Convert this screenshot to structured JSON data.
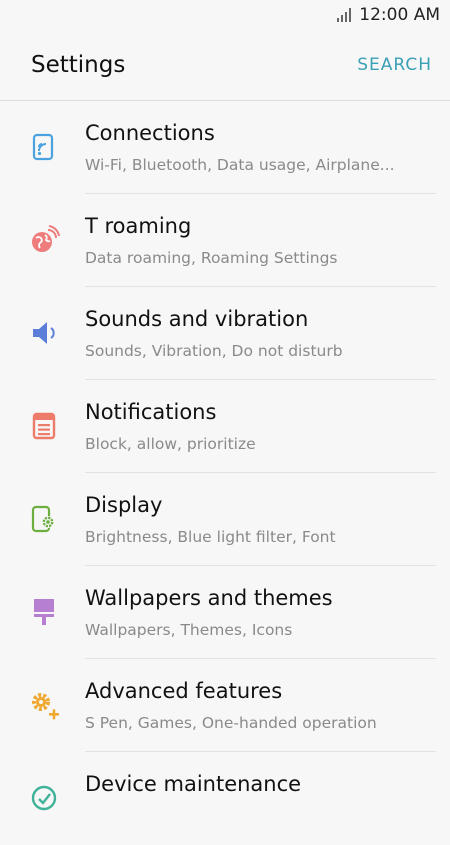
{
  "status_bar": {
    "time": "12:00 AM"
  },
  "header": {
    "title": "Settings",
    "search_label": "SEARCH"
  },
  "items": [
    {
      "label": "Connections",
      "sub": "Wi-Fi, Bluetooth, Data usage, Airplane...",
      "icon": "connections-icon",
      "color": "#4aa3df"
    },
    {
      "label": "T roaming",
      "sub": "Data roaming, Roaming Settings",
      "icon": "globe-roaming-icon",
      "color": "#ee7c7c"
    },
    {
      "label": "Sounds and vibration",
      "sub": "Sounds, Vibration, Do not disturb",
      "icon": "speaker-icon",
      "color": "#5b7fd8"
    },
    {
      "label": "Notifications",
      "sub": "Block, allow, prioritize",
      "icon": "notification-list-icon",
      "color": "#ee7c6a"
    },
    {
      "label": "Display",
      "sub": "Brightness, Blue light filter, Font",
      "icon": "display-gear-icon",
      "color": "#6cae3f"
    },
    {
      "label": "Wallpapers and themes",
      "sub": "Wallpapers, Themes, Icons",
      "icon": "paint-roller-icon",
      "color": "#b77fd0"
    },
    {
      "label": "Advanced features",
      "sub": "S Pen, Games, One-handed operation",
      "icon": "gear-plus-icon",
      "color": "#f0a930"
    },
    {
      "label": "Device maintenance",
      "sub": "",
      "icon": "device-maintenance-icon",
      "color": "#3fb39a"
    }
  ]
}
